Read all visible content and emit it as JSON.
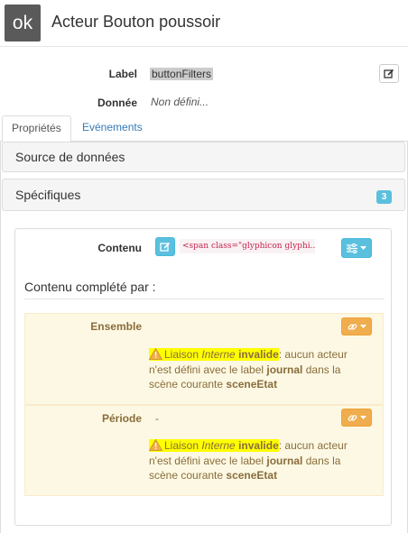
{
  "header": {
    "logo_text": "ok",
    "title": "Acteur Bouton poussoir"
  },
  "fields": {
    "label_caption": "Label",
    "label_value": "buttonFilters",
    "data_caption": "Donnée",
    "data_value": "Non défini..."
  },
  "tabs": [
    {
      "label": "Propriétés",
      "active": true
    },
    {
      "label": "Evénements",
      "active": false
    }
  ],
  "sections": {
    "source": "Source de données",
    "specifics": "Spécifiques",
    "specifics_count": "3"
  },
  "content": {
    "label": "Contenu",
    "code_preview": "<span class=\"glyphicon glyphi..."
  },
  "completed": {
    "title": "Contenu complété par :",
    "items": [
      {
        "label": "Ensemble",
        "value": "",
        "warning": {
          "prefix": "Liaison ",
          "kind": "Interne",
          "status": "invalide",
          "middle": ": aucun acteur n'est défini avec le label ",
          "label_name": "journal",
          "scene_text": " dans la scène courante ",
          "scene_name": "sceneEtat"
        }
      },
      {
        "label": "Période",
        "value": "-",
        "warning": {
          "prefix": "Liaison ",
          "kind": "Interne",
          "status": "invalide",
          "middle": ": aucun acteur n'est défini avec le label ",
          "label_name": "journal",
          "scene_text": " dans la scène courante ",
          "scene_name": "sceneEtat"
        }
      }
    ]
  },
  "colors": {
    "info": "#5bc0de",
    "warning": "#f0ad4e",
    "warning_bg": "#fcf8e3",
    "warning_text": "#8a6d3b",
    "link": "#337ab7",
    "highlight": "#ffff00"
  }
}
